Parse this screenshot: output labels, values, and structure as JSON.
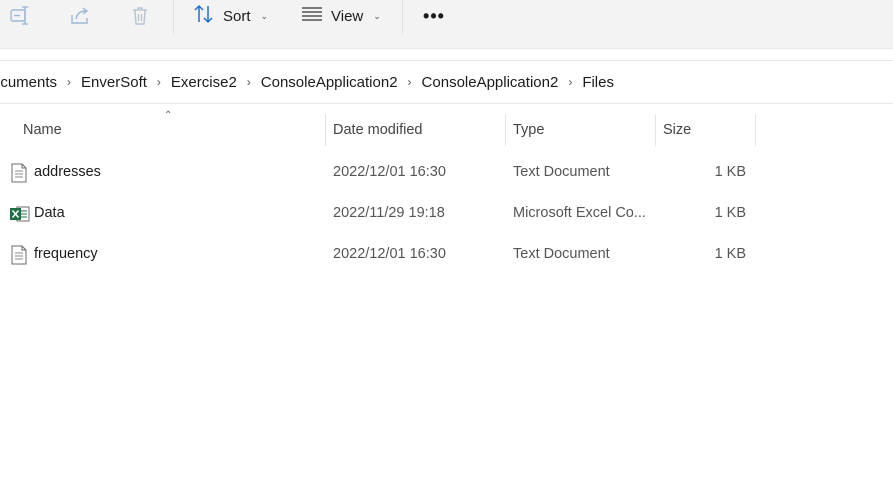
{
  "toolbar": {
    "sort_label": "Sort",
    "view_label": "View",
    "more_label": "•••"
  },
  "breadcrumb": [
    "ocuments",
    "EnverSoft",
    "Exercise2",
    "ConsoleApplication2",
    "ConsoleApplication2",
    "Files"
  ],
  "columns": {
    "name": "Name",
    "date": "Date modified",
    "type": "Type",
    "size": "Size"
  },
  "files": [
    {
      "name": "addresses",
      "date": "2022/12/01 16:30",
      "type": "Text Document",
      "size": "1 KB",
      "icon": "text-document-icon"
    },
    {
      "name": "Data",
      "date": "2022/11/29 19:18",
      "type": "Microsoft Excel Co...",
      "size": "1 KB",
      "icon": "excel-icon"
    },
    {
      "name": "frequency",
      "date": "2022/12/01 16:30",
      "type": "Text Document",
      "size": "1 KB",
      "icon": "text-document-icon"
    }
  ],
  "colors": {
    "toolbar_bg": "#f3f3f3",
    "accent": "#1e6fd0",
    "excel_green": "#1d7044"
  }
}
